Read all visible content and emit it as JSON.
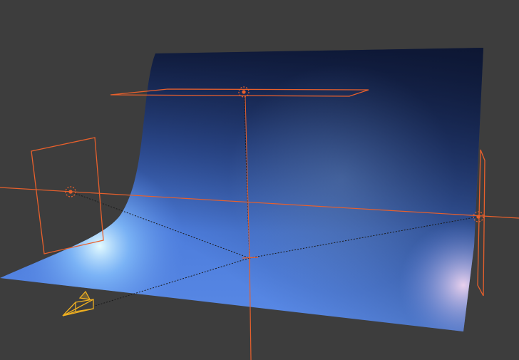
{
  "viewport": {
    "background_color": "#3d3d3d",
    "selection_color": "#e8602c",
    "camera_color": "#f0b020",
    "backdrop_top_color": "#14234a",
    "backdrop_mid_color": "#4f7fd8",
    "backdrop_highlight_color": "#d8f4ff"
  },
  "objects": [
    {
      "name": "backdrop",
      "icon": "plane-mesh"
    },
    {
      "name": "top-area-light",
      "icon": "area-light"
    },
    {
      "name": "left-area-light",
      "icon": "area-light"
    },
    {
      "name": "right-area-light",
      "icon": "area-light"
    },
    {
      "name": "camera",
      "icon": "camera"
    },
    {
      "name": "empty-target",
      "icon": "empty"
    }
  ]
}
